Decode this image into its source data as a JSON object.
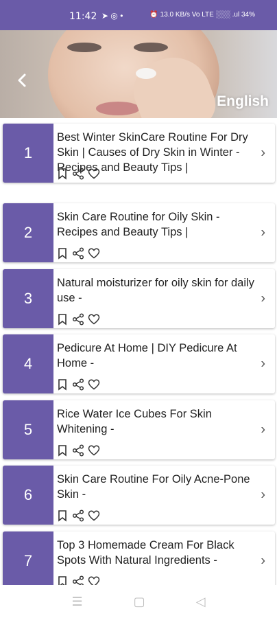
{
  "status_bar": {
    "time": "11:42",
    "left_icons": "➤ ◎ •",
    "right_text": "⏰ 13.0 KB/s  Vo LTE  ░░░ .ul 34%"
  },
  "header": {
    "back_label": "‹",
    "language": "English"
  },
  "articles": [
    {
      "number": "1",
      "title": "Best Winter SkinCare Routine For Dry Skin | Causes of Dry Skin in Winter - Recipes and Beauty Tips |"
    },
    {
      "number": "2",
      "title": "Skin Care Routine for Oily Skin - Recipes and Beauty Tips |"
    },
    {
      "number": "3",
      "title": "Natural moisturizer for oily skin for daily use -"
    },
    {
      "number": "4",
      "title": "Pedicure At Home | DIY Pedicure At Home -"
    },
    {
      "number": "5",
      "title": "Rice Water Ice Cubes For Skin Whitening -"
    },
    {
      "number": "6",
      "title": "Skin Care Routine For Oily Acne-Pone Skin -"
    },
    {
      "number": "7",
      "title": "Top 3 Homemade Cream For Black Spots With Natural Ingredients -"
    }
  ],
  "chevron": "›",
  "nav_bar": {
    "menu": "☰",
    "home": "▢",
    "back": "◁"
  },
  "colors": {
    "accent": "#6a5ba8",
    "status_bar": "#6a5ba8"
  }
}
